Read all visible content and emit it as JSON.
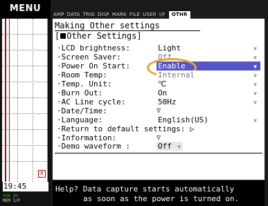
{
  "left": {
    "menu_label": "MENU",
    "time": "19:45",
    "marker": "R",
    "indicators": {
      "usb": "USB",
      "mem": "GH",
      "line2": "MEM I/F"
    }
  },
  "tabs": [
    "AMP",
    "DATA",
    "TRIG",
    "DISP",
    "MARK",
    "FILE",
    "USER",
    "I/F",
    "OTHR"
  ],
  "panel": {
    "title": "Making Other settings",
    "section": "[",
    "section_label": "Other Settings]",
    "items": [
      {
        "label": "·LCD brightness:",
        "value": "Light"
      },
      {
        "label": "·Screen Saver:",
        "value": "Off"
      },
      {
        "label": "·Power On Start:",
        "value": "Enable"
      },
      {
        "label": "·Room Temp:",
        "value": "Internal"
      },
      {
        "label": "·Temp. Unit:",
        "value": "℃"
      },
      {
        "label": "·Burn Out:",
        "value": "On"
      },
      {
        "label": "·AC Line cycle:",
        "value": "50Hz"
      },
      {
        "label": "·Date/Time:",
        "value": "▽"
      },
      {
        "label": "·Language:",
        "value": "English(US)"
      }
    ],
    "return_label": "·Return to default settings: ▷",
    "information_label": "·Information:",
    "information_value": "▽",
    "demo_label": "·Demo waveform :",
    "demo_value": "Off"
  },
  "help": {
    "line1": "Help? Data capture starts automatically",
    "line2": "as soon as the power is turned on."
  },
  "colors": {
    "highlight": "#5555c8",
    "ring": "#f0a030"
  }
}
